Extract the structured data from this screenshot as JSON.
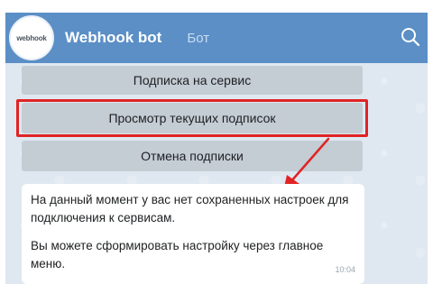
{
  "header": {
    "avatar_text": "webhook",
    "bot_name": "Webhook bot",
    "status": "Бот",
    "search_icon": "search-icon"
  },
  "keyboard": {
    "buttons": [
      {
        "label": "Подписка на сервис"
      },
      {
        "label": "Просмотр текущих подписок"
      },
      {
        "label": "Отмена подписки"
      }
    ]
  },
  "annotation": {
    "highlight_color": "#e02424"
  },
  "message": {
    "paragraph_1": "На данный момент у вас нет сохраненных настроек для подключения к сервисам.",
    "paragraph_2": "Вы можете сформировать настройку через главное меню.",
    "time": "10:04"
  },
  "colors": {
    "header_bg": "#5b8fc6",
    "chat_bg": "#dfe8f1",
    "button_bg": "#c4ccd4"
  }
}
